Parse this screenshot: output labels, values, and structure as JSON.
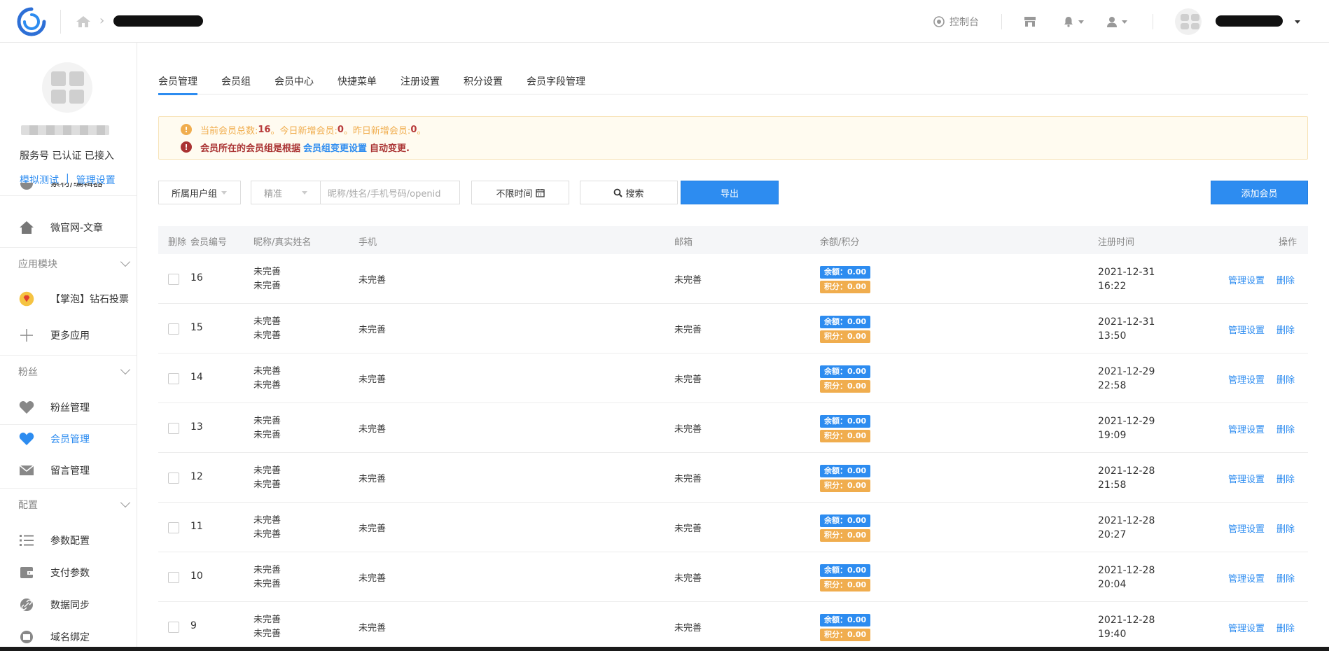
{
  "header": {
    "console_label": "控制台",
    "icons": [
      "logo-icon",
      "home-icon",
      "console-icon",
      "store-icon",
      "bell-icon",
      "user-icon"
    ]
  },
  "sidebar": {
    "status": "服务号 已认证 已接入",
    "link_test": "模拟测试",
    "link_sep": "|",
    "link_manage": "管理设置",
    "items": {
      "partial": "素材/编辑器",
      "website": "微官网-文章",
      "group_modules": "应用模块",
      "vote": "【掌泡】钻石投票",
      "more_apps": "更多应用",
      "group_fans": "粉丝",
      "fans_manage": "粉丝管理",
      "member_manage": "会员管理",
      "message_manage": "留言管理",
      "group_config": "配置",
      "param_config": "参数配置",
      "pay_params": "支付参数",
      "data_sync": "数据同步",
      "domain_bind": "域名绑定"
    }
  },
  "tabs": [
    "会员管理",
    "会员组",
    "会员中心",
    "快捷菜单",
    "注册设置",
    "积分设置",
    "会员字段管理"
  ],
  "notice": {
    "line1_a": "当前会员总数:",
    "total": "16",
    "line1_b": "。今日新增会员:",
    "today": "0",
    "line1_c": "。昨日新增会员:",
    "yesterday": "0",
    "line1_d": "。",
    "line2_a": "会员所在的会员组是根据",
    "line2_link": "会员组变更设置",
    "line2_b": "自动变更."
  },
  "toolbar": {
    "group_select": "所属用户组",
    "match_select": "精准",
    "search_placeholder": "昵称/姓名/手机号码/openid",
    "time_button": "不限时间",
    "search_button": "搜索",
    "export_button": "导出",
    "add_button": "添加会员"
  },
  "table": {
    "headers": {
      "select": "删除",
      "id": "会员编号",
      "name": "昵称/真实姓名",
      "phone": "手机",
      "email": "邮箱",
      "balance": "余额/积分",
      "reg_time": "注册时间",
      "actions": "操作"
    },
    "balance_prefix": "余额：",
    "points_prefix": "积分：",
    "op_manage": "管理设置",
    "op_delete": "删除",
    "rows": [
      {
        "id": "16",
        "nick": "未完善",
        "real": "未完善",
        "phone": "未完善",
        "email": "未完善",
        "balance": "0.00",
        "points": "0.00",
        "date": "2021-12-31",
        "time": "16:22"
      },
      {
        "id": "15",
        "nick": "未完善",
        "real": "未完善",
        "phone": "未完善",
        "email": "未完善",
        "balance": "0.00",
        "points": "0.00",
        "date": "2021-12-31",
        "time": "13:50"
      },
      {
        "id": "14",
        "nick": "未完善",
        "real": "未完善",
        "phone": "未完善",
        "email": "未完善",
        "balance": "0.00",
        "points": "0.00",
        "date": "2021-12-29",
        "time": "22:58"
      },
      {
        "id": "13",
        "nick": "未完善",
        "real": "未完善",
        "phone": "未完善",
        "email": "未完善",
        "balance": "0.00",
        "points": "0.00",
        "date": "2021-12-29",
        "time": "19:09"
      },
      {
        "id": "12",
        "nick": "未完善",
        "real": "未完善",
        "phone": "未完善",
        "email": "未完善",
        "balance": "0.00",
        "points": "0.00",
        "date": "2021-12-28",
        "time": "21:58"
      },
      {
        "id": "11",
        "nick": "未完善",
        "real": "未完善",
        "phone": "未完善",
        "email": "未完善",
        "balance": "0.00",
        "points": "0.00",
        "date": "2021-12-28",
        "time": "20:27"
      },
      {
        "id": "10",
        "nick": "未完善",
        "real": "未完善",
        "phone": "未完善",
        "email": "未完善",
        "balance": "0.00",
        "points": "0.00",
        "date": "2021-12-28",
        "time": "20:04"
      },
      {
        "id": "9",
        "nick": "未完善",
        "real": "未完善",
        "phone": "未完善",
        "email": "未完善",
        "balance": "0.00",
        "points": "0.00",
        "date": "2021-12-28",
        "time": "19:40"
      }
    ]
  },
  "colors": {
    "accent": "#2d8cf0",
    "warning": "#f0ad4e",
    "danger": "#b83b3b"
  }
}
